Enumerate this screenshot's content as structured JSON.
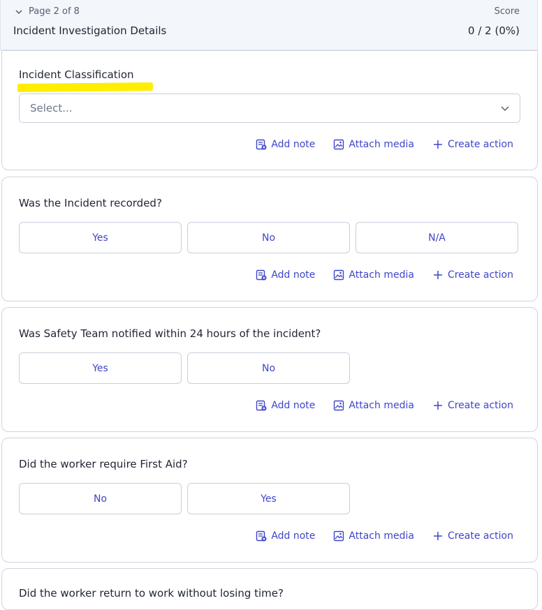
{
  "header": {
    "page_label": "Page 2 of 8",
    "title": "Incident Investigation Details",
    "score_label": "Score",
    "score_value": "0 / 2 (0%)"
  },
  "actions": {
    "add_note": "Add note",
    "attach_media": "Attach media",
    "create_action": "Create action"
  },
  "questions": [
    {
      "title": "Incident Classification",
      "type": "select",
      "placeholder": "Select...",
      "highlighted": true
    },
    {
      "title": "Was the Incident recorded?",
      "type": "buttons",
      "options": [
        "Yes",
        "No",
        "N/A"
      ]
    },
    {
      "title": "Was Safety Team notified within 24 hours of the incident?",
      "type": "buttons",
      "options": [
        "Yes",
        "No"
      ]
    },
    {
      "title": "Did the worker require First Aid?",
      "type": "buttons",
      "options": [
        "No",
        "Yes"
      ]
    },
    {
      "title": "Did the worker return to work without losing time?",
      "type": "buttons",
      "options": []
    }
  ],
  "colors": {
    "accent": "#3f45c8",
    "highlight": "#ffee00",
    "header_bg": "#f3f6fb",
    "border": "#d0d4dc"
  }
}
